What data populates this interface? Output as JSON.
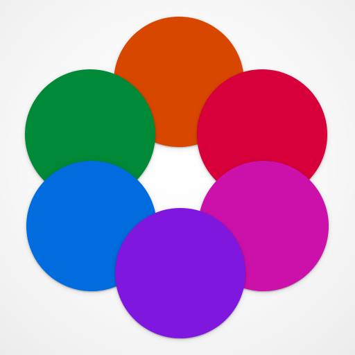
{
  "logo": {
    "petals": [
      {
        "name": "orange",
        "color": "#D84700"
      },
      {
        "name": "red",
        "color": "#D7003A"
      },
      {
        "name": "green",
        "color": "#008936"
      },
      {
        "name": "magenta",
        "color": "#CC11AB"
      },
      {
        "name": "blue",
        "color": "#006CDE"
      },
      {
        "name": "purple",
        "color": "#7F17DE"
      }
    ]
  }
}
